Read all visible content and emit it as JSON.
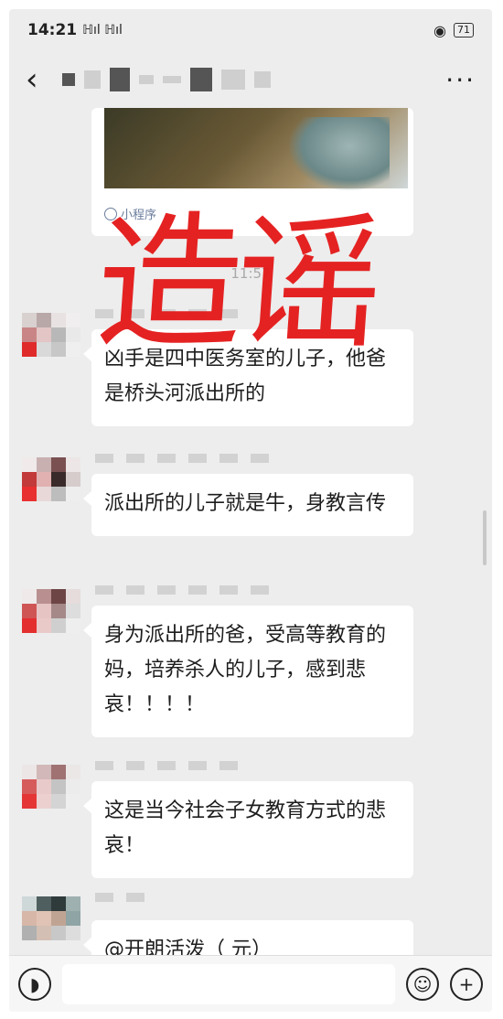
{
  "status_bar": {
    "time": "14:21",
    "signal_text": "ℍıl ℍıl",
    "battery": "71"
  },
  "nav": {
    "back_icon": "chevron-left-icon",
    "title": "",
    "more": "···"
  },
  "shared_card": {
    "footer_label": "小程序"
  },
  "timestamp": "11:57",
  "watermark": "造谣",
  "messages": [
    {
      "text": "凶手是四中医务室的儿子，他爸是桥头河派出所的"
    },
    {
      "text": "派出所的儿子就是牛，身教言传"
    },
    {
      "text": "身为派出所的爸，受高等教育的妈，培养杀人的儿子，感到悲哀！！！！"
    },
    {
      "text": "这是当今社会子女教育方式的悲哀！"
    },
    {
      "text": "@开朗活泼（        元）"
    }
  ],
  "input_bar": {
    "voice_icon": "voice-icon",
    "emoji_icon": "emoji-icon",
    "plus_icon": "plus-icon",
    "placeholder": ""
  },
  "colors": {
    "chat_bg": "#ededed",
    "bubble_bg": "#ffffff",
    "watermark_red": "#e41a1a"
  }
}
